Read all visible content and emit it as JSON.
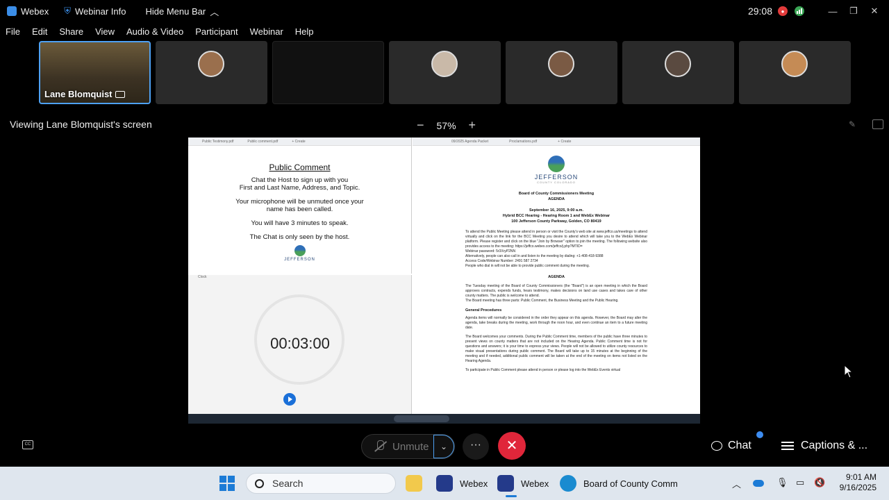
{
  "titlebar": {
    "app_name": "Webex",
    "webinar_info": "Webinar Info",
    "hide_menu": "Hide Menu Bar",
    "timer": "29:08",
    "window_controls": [
      "—",
      "❐",
      "✕"
    ]
  },
  "menu": [
    "File",
    "Edit",
    "Share",
    "View",
    "Audio & Video",
    "Participant",
    "Webinar",
    "Help"
  ],
  "participants": [
    {
      "name": "Lane Blomquist",
      "active": true
    },
    {
      "name": ""
    },
    {
      "name": ""
    },
    {
      "name": ""
    },
    {
      "name": ""
    },
    {
      "name": ""
    },
    {
      "name": ""
    }
  ],
  "viewing": {
    "label": "Viewing Lane Blomquist's screen",
    "zoom_minus": "−",
    "zoom_level": "57%",
    "zoom_plus": "+"
  },
  "shared": {
    "left_tabs": [
      "Public Testimony.pdf",
      "Public comment.pdf",
      "+ Create"
    ],
    "right_tabs": [
      "09/2025 Agenda Packet",
      "Proclamations.pdf",
      "+ Create"
    ],
    "public_comment": {
      "title": "Public Comment",
      "lines": [
        "Chat the Host to sign up with you",
        "First and Last Name, Address, and Topic.",
        "",
        "Your microphone will be unmuted once your",
        "name has been called.",
        "",
        "You will have 3 minutes to speak.",
        "",
        "The Chat is only seen by the host."
      ],
      "logo_text": "JEFFERSON"
    },
    "clock_window_title": "Clock",
    "clock_time": "00:03:00",
    "agenda": {
      "logo_text": "JEFFERSON",
      "logo_sub": "COUNTY COLORADO",
      "heading1": "Board of County Commissioners Meeting",
      "heading2": "AGENDA",
      "date": "September 16, 2025, 9:00 a.m.",
      "location1": "Hybrid BCC Hearing - Hearing Room 1 and WebEx Webinar",
      "location2": "100 Jefferson County Parkway, Golden, CO 80419",
      "para1": "To attend the Public Meeting please attend in person or visit the County's web site at www.jeffco.us/meetings to attend virtually and click on the link for the BCC Meeting you desire to attend which will take you to the WebEx Webinar platform. Please register and click on the blue \"Join by Browser\" option to join the meeting. The following website also provides access to the meeting: https://jeffco.webex.com/jeffco/j.php?MTID=",
      "para2": "Webinar password: 5r3XryP2NN",
      "para3": "Alternatively, people can also call in and listen to the meeting by dialing: +1-408-418-9388",
      "para4": "Access Code/Webinar Number: 2491 587 2734",
      "para5": "People who dial in will not be able to provide public comment during the meeting.",
      "heading3": "AGENDA",
      "para6": "The Tuesday meeting of the Board of County Commissioners (the \"Board\") is an open meeting in which the Board approves contracts, expends funds, hears testimony, makes decisions on land use cases and takes care of other county matters. The public is welcome to attend.",
      "para7": "The Board meeting has three parts: Public Comment, the Business Meeting and the Public Hearing.",
      "heading4": "General Procedures",
      "para8": "Agenda items will normally be considered in the order they appear on this agenda. However, the Board may alter the agenda, take breaks during the meeting, work through the noon hour, and even continue an item to a future meeting date.",
      "para9": "The Board welcomes your comments. During the Public Comment time, members of the public have three minutes to present views on county matters that are not included on the Hearing Agenda. Public Comment time is not for questions and answers; it is your time to express your views. People will not be allowed to utilize county resources to make visual presentations during public comment. The Board will take up to 15 minutes at the beginning of the meeting and if needed, additional public comment will be taken at the end of the meeting on items not listed on the Hearing Agenda.",
      "para10": "To participate in Public Comment please attend in person or please log into the WebEx Events virtual"
    }
  },
  "controls": {
    "unmute": "Unmute",
    "more": "···",
    "leave": "✕",
    "chat": "Chat",
    "captions": "Captions & ..."
  },
  "taskbar": {
    "search": "Search",
    "apps": [
      {
        "label": "Webex",
        "color": "#243a8a"
      },
      {
        "label": "Webex",
        "color": "#243a8a"
      },
      {
        "label": "Board of County Comm",
        "color": "#1a8bd0"
      }
    ],
    "time": "9:01 AM",
    "date": "9/16/2025"
  }
}
